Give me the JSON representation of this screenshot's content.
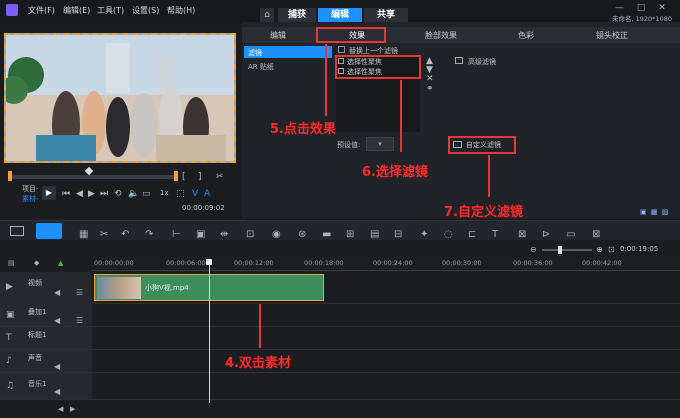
{
  "menubar": {
    "items": [
      "文件(F)",
      "编辑(E)",
      "工具(T)",
      "设置(S)",
      "帮助(H)"
    ],
    "project_info": "未命名, 1920*1080"
  },
  "main_tabs": [
    "捕获",
    "编辑",
    "共享"
  ],
  "sub_tabs": [
    "编辑",
    "效果",
    "脸部效果",
    "色彩",
    "镜头校正"
  ],
  "effect_categories": [
    "滤镜",
    "AR 贴纸"
  ],
  "replace_filter_label": "替换上一个滤镜",
  "filters_list": [
    "选择性聚焦",
    "选择性聚焦"
  ],
  "advanced_filter_label": "高级滤镜",
  "preset_label": "预设值:",
  "custom_filter_label": "自定义滤镜",
  "player": {
    "project_label": "项目-",
    "clip_label": "素材-",
    "timecode": "00:00:09:02",
    "speed_tag": "1x"
  },
  "timeline": {
    "timecode_display": "0:00:19:05",
    "ruler_ticks": [
      "00:00:00:00",
      "00:00:06:00",
      "00:00:12:00",
      "00:00:18:00",
      "00:00:24:00",
      "00:00:30:00",
      "00:00:36:00",
      "00:00:42:00"
    ],
    "tracks": [
      "视频",
      "叠加1",
      "标题1",
      "声音",
      "音乐1"
    ],
    "clip_name": "小狗V视.mp4"
  },
  "annotations": {
    "step5": "5.点击效果",
    "step6": "6.选择滤镜",
    "step7": "7.自定义滤镜",
    "step4": "4.双击素材"
  },
  "colors": {
    "accent": "#1e90ff",
    "annotation": "#ff2a2a",
    "clip_green": "#3e8d5c",
    "preview_border": "#f2a13a"
  }
}
